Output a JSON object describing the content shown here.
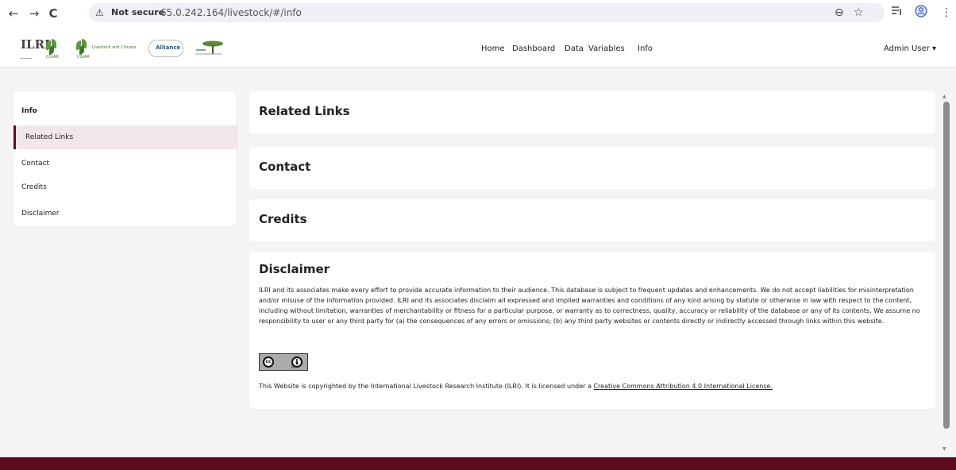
{
  "browser": {
    "back": "←",
    "forward": "→",
    "reload": "C",
    "warning_icon": "⚠",
    "security_label": "Not secure",
    "url": "65.0.242.164/livestock/#/info",
    "zoom_icon": "⊖",
    "star_icon": "☆",
    "menu_icon": "⋮"
  },
  "header": {
    "logos": {
      "ilri": "ILRI",
      "cgiar": "CGIAR",
      "livestock_climate": "Livestock and Climate",
      "alliance": "Alliance"
    },
    "nav": [
      "Home",
      "Dashboard",
      "Data",
      "Variables",
      "Info"
    ],
    "user_menu": "Admin User ▾"
  },
  "sidebar": {
    "title": "Info",
    "items": [
      {
        "label": "Related Links",
        "active": true
      },
      {
        "label": "Contact"
      },
      {
        "label": "Credits"
      },
      {
        "label": "Disclaimer"
      }
    ]
  },
  "sections": {
    "related_links": "Related Links",
    "contact": "Contact",
    "credits": "Credits",
    "disclaimer": {
      "title": "Disclaimer",
      "body": "ILRI and its associates make every effort to provide accurate information to their audience. This database is subject to frequent updates and enhancements. We do not accept liabilities for misinterpretation and/or misuse of the information provided. ILRI and its associates disclaim all expressed and implied warranties and conditions of any kind arising by statute or otherwise in law with respect to the content, including without limitation, warranties of merchantability or fitness for a particular purpose, or warranty as to correctness, quality, accuracy or reliability of the database or any of its contents. We assume no responsibility to user or any third party for (a) the consequences of any errors or omissions; (b) any third party websites or contents directly or indirectly accessed through links within this website.",
      "cc_badge": {
        "cc": "cc",
        "by": "BY"
      },
      "copyright_prefix": "This Website is copyrighted by the International Livestock Research Institute (ILRI). It is licensed under a ",
      "license_link": "Creative Commons Attribution 4.0 International License."
    }
  },
  "colors": {
    "brand": "#5e0a24",
    "active_bg": "#f1e7ea",
    "page_bg": "#f4f4f4"
  }
}
